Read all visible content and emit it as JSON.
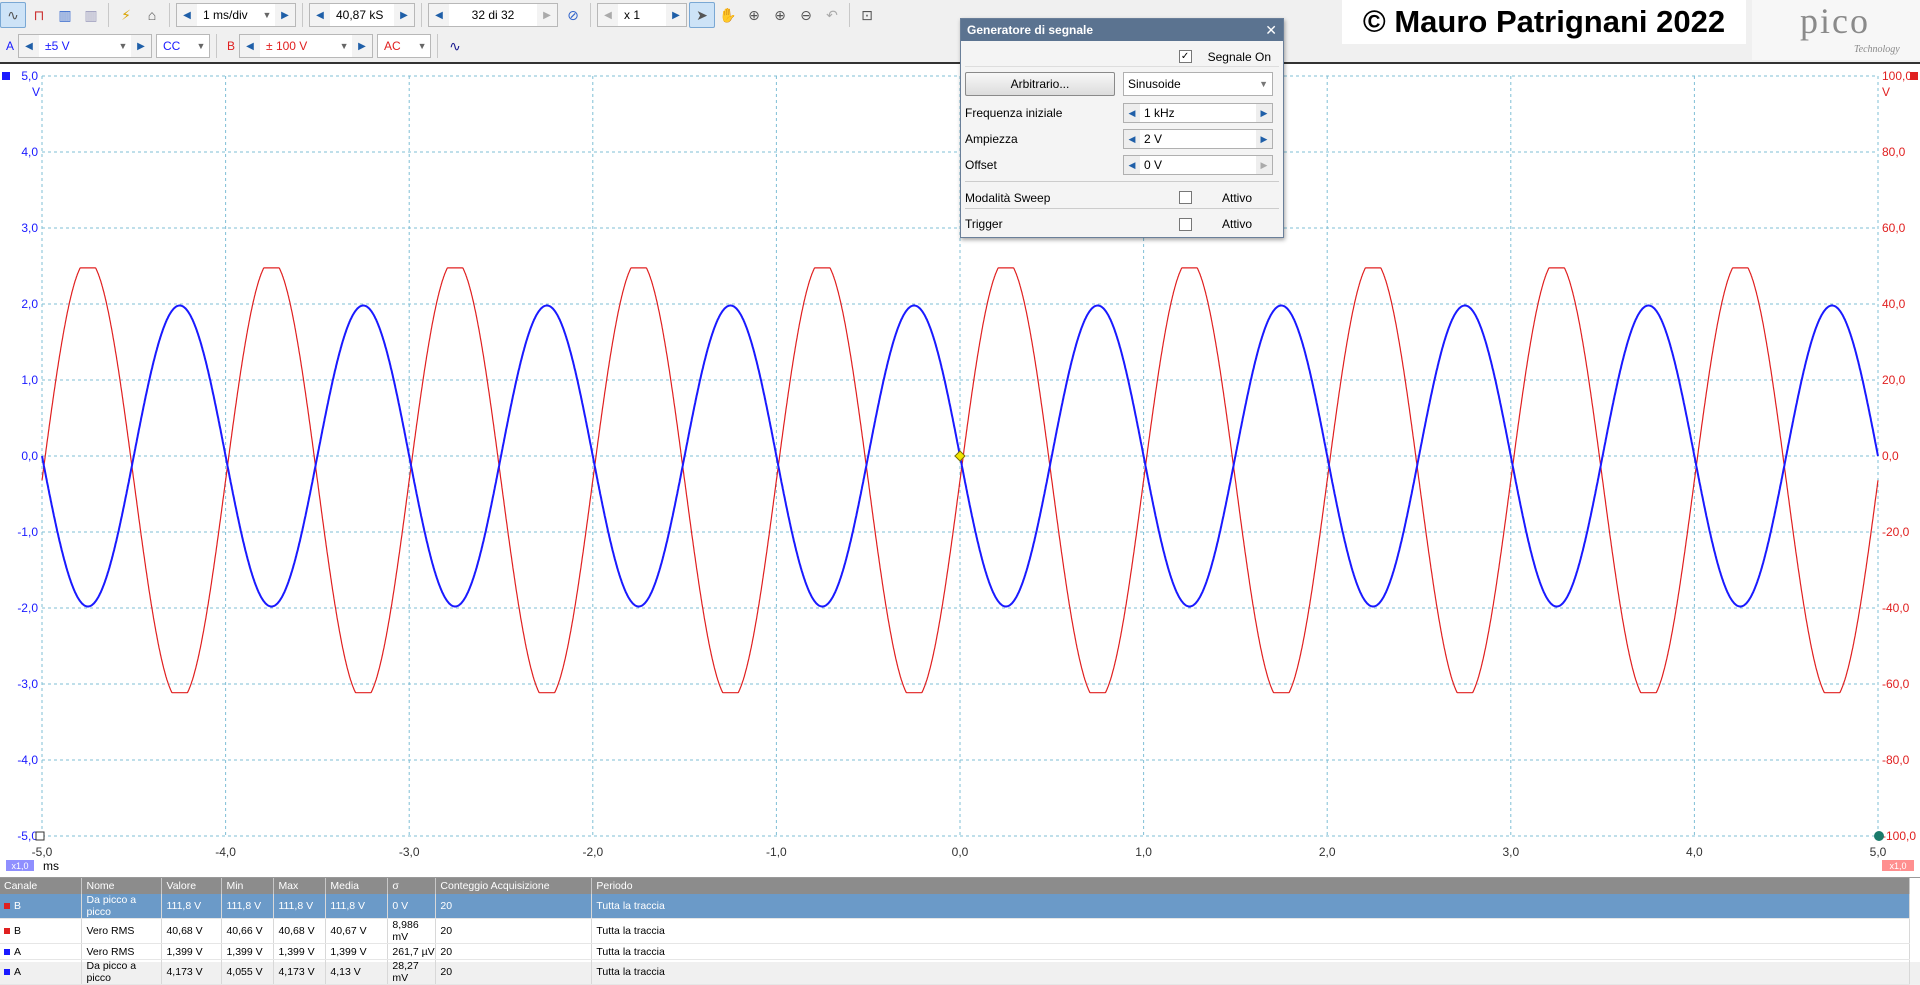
{
  "toolbar": {
    "timebase": "1 ms/div",
    "samples": "40,87 kS",
    "buffer": "32 di 32",
    "zoom": "x 1",
    "channel_a": {
      "label": "A",
      "range": "±5 V",
      "coupling": "CC",
      "color": "#1a1aff"
    },
    "channel_b": {
      "label": "B",
      "range": "± 100 V",
      "coupling": "AC",
      "color": "#e02020"
    }
  },
  "copyright": "© Mauro Patrignani 2022",
  "logo": {
    "name": "pico",
    "sub": "Technology"
  },
  "scope": {
    "left_axis_unit": "V",
    "right_axis_unit": "V",
    "left_ticks": [
      "5,0",
      "4,0",
      "3,0",
      "2,0",
      "1,0",
      "0,0",
      "-1,0",
      "-2,0",
      "-3,0",
      "-4,0",
      "-5,0"
    ],
    "right_ticks": [
      "100,0",
      "80,0",
      "60,0",
      "40,0",
      "20,0",
      "0,0",
      "-20,0",
      "-40,0",
      "-60,0",
      "-80,0",
      "-100,0"
    ],
    "x_ticks": [
      "-5,0",
      "-4,0",
      "-3,0",
      "-2,0",
      "-1,0",
      "0,0",
      "1,0",
      "2,0",
      "3,0",
      "4,0",
      "5,0"
    ],
    "x_unit": "ms",
    "zoom_left": "x1,0",
    "zoom_right": "x1,0"
  },
  "chart_data": {
    "type": "line",
    "xlabel": "ms",
    "ylabel": "V",
    "xlim": [
      -5,
      5
    ],
    "ylim": [
      -5,
      5
    ],
    "y2lim": [
      -100,
      100
    ],
    "grid": true,
    "series": [
      {
        "name": "A",
        "axis": "left",
        "frequency_khz": 1,
        "amplitude": 1.98,
        "offset": 0,
        "phase_deg": 180,
        "color": "#1a1aff"
      },
      {
        "name": "B",
        "axis": "right",
        "frequency_khz": 1,
        "amplitude_peak_to_peak": 111.8,
        "max": 49.5,
        "min": -62.3,
        "phase_deg": 0,
        "color": "#e02020"
      }
    ]
  },
  "siggen": {
    "title": "Generatore di segnale",
    "signal_on_label": "Segnale On",
    "signal_on": true,
    "arbitrary_button": "Arbitrario...",
    "waveform": "Sinusoide",
    "start_freq_label": "Frequenza iniziale",
    "start_freq": "1 kHz",
    "amplitude_label": "Ampiezza",
    "amplitude": "2 V",
    "offset_label": "Offset",
    "offset": "0 V",
    "sweep_label": "Modalità Sweep",
    "sweep_state": "Attivo",
    "trigger_label": "Trigger",
    "trigger_state": "Attivo"
  },
  "measurements": {
    "columns": [
      "Canale",
      "Nome",
      "Valore",
      "Min",
      "Max",
      "Media",
      "σ",
      "Conteggio Acquisizione",
      "Periodo"
    ],
    "rows": [
      [
        "B",
        "Da picco a picco",
        "111,8 V",
        "111,8 V",
        "111,8 V",
        "111,8 V",
        "0 V",
        "20",
        "Tutta la traccia"
      ],
      [
        "B",
        "Vero RMS",
        "40,68 V",
        "40,66 V",
        "40,68 V",
        "40,67 V",
        "8,986 mV",
        "20",
        "Tutta la traccia"
      ],
      [
        "A",
        "Vero RMS",
        "1,399 V",
        "1,399 V",
        "1,399 V",
        "1,399 V",
        "261,7 µV",
        "20",
        "Tutta la traccia"
      ],
      [
        "A",
        "Da picco a picco",
        "4,173 V",
        "4,055 V",
        "4,173 V",
        "4,13 V",
        "28,27 mV",
        "20",
        "Tutta la traccia"
      ]
    ]
  }
}
